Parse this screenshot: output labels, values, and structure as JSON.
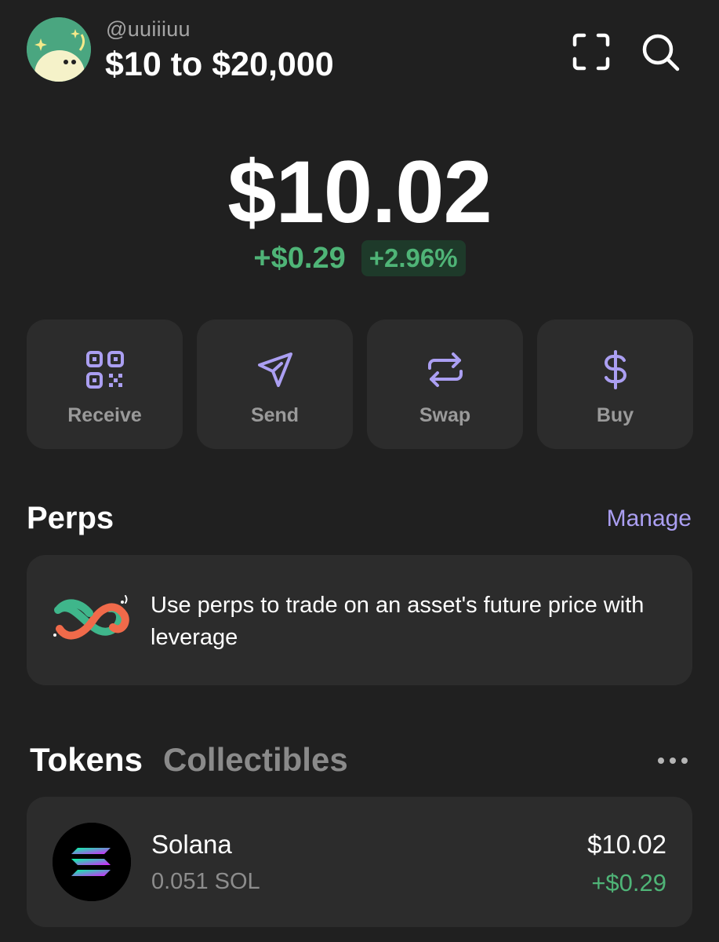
{
  "header": {
    "username": "@uuiiiuu",
    "account_name": "$10 to $20,000",
    "avatar_icon": "ghost-avatar-icon",
    "scan_icon": "scan-icon",
    "search_icon": "search-icon"
  },
  "balance": {
    "total": "$10.02",
    "change_abs": "+$0.29",
    "change_pct": "+2.96%"
  },
  "actions": [
    {
      "label": "Receive",
      "icon": "qr-code-icon"
    },
    {
      "label": "Send",
      "icon": "paper-plane-icon"
    },
    {
      "label": "Swap",
      "icon": "swap-arrows-icon"
    },
    {
      "label": "Buy",
      "icon": "dollar-icon"
    }
  ],
  "perps": {
    "title": "Perps",
    "manage_label": "Manage",
    "description": "Use perps to trade on an asset's future price with leverage",
    "icon": "perps-loop-icon"
  },
  "tabs": {
    "active": "Tokens",
    "inactive": "Collectibles",
    "more_icon": "more-dots-icon"
  },
  "tokens": [
    {
      "name": "Solana",
      "amount": "0.051 SOL",
      "value": "$10.02",
      "change": "+$0.29",
      "icon": "solana-logo-icon"
    }
  ],
  "colors": {
    "background": "#202020",
    "card": "#2c2c2c",
    "accent": "#ab9ff2",
    "positive": "#4fb477"
  }
}
